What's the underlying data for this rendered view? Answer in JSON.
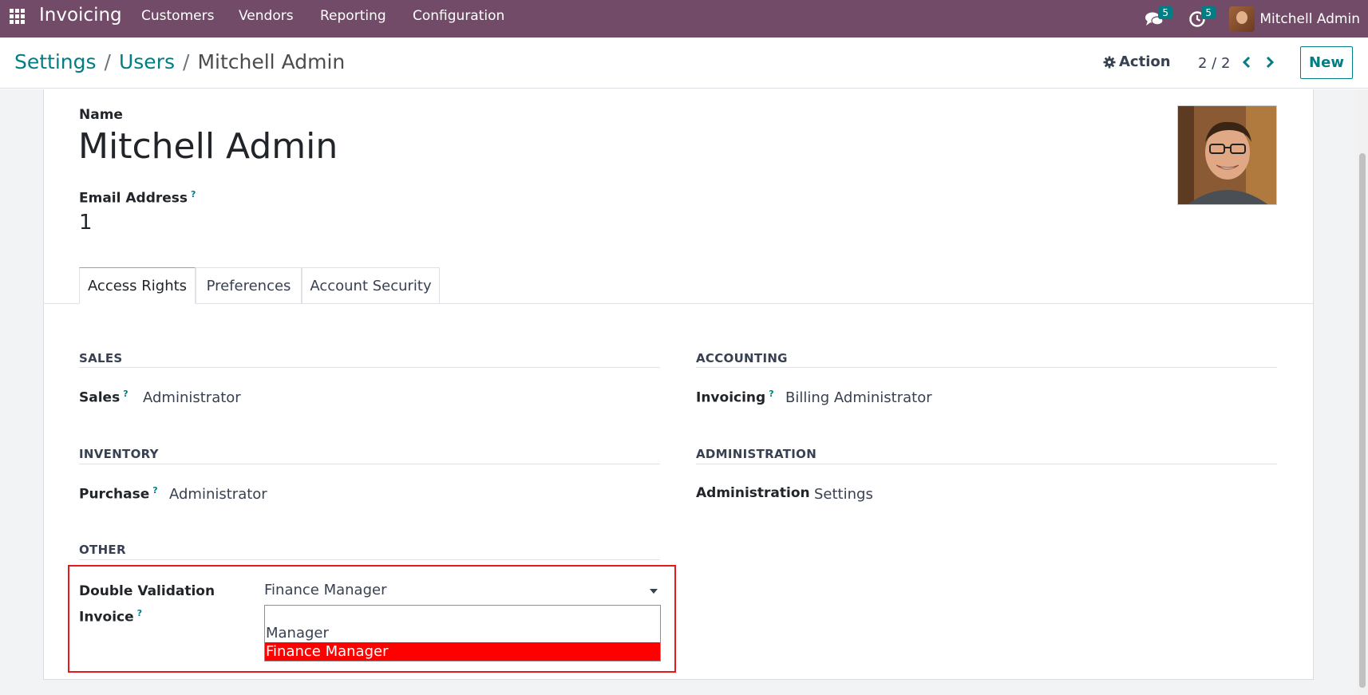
{
  "navbar": {
    "brand": "Invoicing",
    "menu": [
      "Customers",
      "Vendors",
      "Reporting",
      "Configuration"
    ],
    "messages_count": "5",
    "activities_count": "5",
    "user_name": "Mitchell Admin"
  },
  "breadcrumb": {
    "items": [
      "Settings",
      "Users"
    ],
    "current": "Mitchell Admin"
  },
  "control": {
    "action_label": "Action",
    "pager": "2 / 2",
    "new_label": "New"
  },
  "form": {
    "name_label": "Name",
    "name_value": "Mitchell Admin",
    "email_label": "Email Address",
    "email_help": "?",
    "email_value": "1"
  },
  "tabs": [
    "Access Rights",
    "Preferences",
    "Account Security"
  ],
  "sections": {
    "sales": {
      "title": "SALES",
      "field_label": "Sales",
      "field_help": "?",
      "field_value": "Administrator"
    },
    "accounting": {
      "title": "ACCOUNTING",
      "field_label": "Invoicing",
      "field_help": "?",
      "field_value": "Billing Administrator"
    },
    "inventory": {
      "title": "INVENTORY",
      "field_label": "Purchase",
      "field_help": "?",
      "field_value": "Administrator"
    },
    "administration": {
      "title": "ADMINISTRATION",
      "field_label": "Administration",
      "field_value": "Settings"
    },
    "other": {
      "title": "OTHER",
      "field_label_line1": "Double Validation",
      "field_label_line2": "Invoice",
      "field_help": "?",
      "select_value": "Finance Manager",
      "options": [
        "",
        "Manager",
        "Finance Manager"
      ]
    }
  },
  "colors": {
    "navbar": "#714B67",
    "accent": "#017e84",
    "highlight_border": "#e5181b",
    "selected_option": "#ff0000"
  }
}
